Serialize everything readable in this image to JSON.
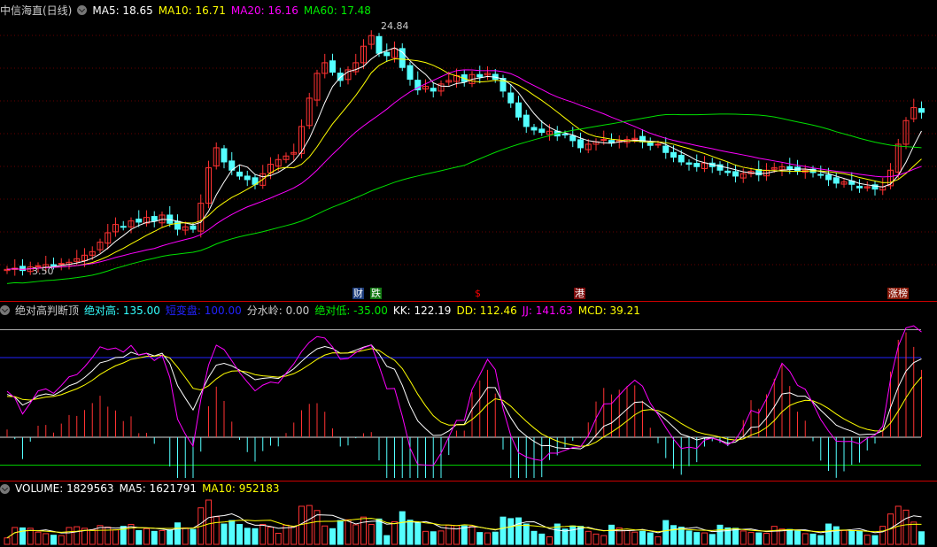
{
  "main": {
    "title": "中信海直(日线)",
    "ma5": "MA5: 18.65",
    "ma10": "MA10: 16.71",
    "ma20": "MA20: 16.16",
    "ma60": "MA60: 17.48",
    "high_label": "24.84",
    "low_label": "3.50",
    "markers": [
      {
        "text": "财",
        "bg": "#1a3a7a",
        "color": "#fff"
      },
      {
        "text": "跌",
        "bg": "#137a13",
        "color": "#fff"
      },
      {
        "text": "$",
        "bg": "transparent",
        "color": "#f00"
      },
      {
        "text": "港",
        "bg": "#7a0a0a",
        "color": "#fff"
      },
      {
        "text": "涨榜",
        "bg": "#8a1a0a",
        "color": "#fff"
      }
    ]
  },
  "indicator": {
    "name": "绝对高判断顶",
    "abs_high": "绝对高: 135.00",
    "short_change": "短变盘: 100.00",
    "watershed": "分水岭: 0.00",
    "abs_low": "绝对低: -35.00",
    "kk": "KK: 122.19",
    "dd": "DD: 112.46",
    "jj": "JJ: 141.63",
    "mcd": "MCD: 39.21"
  },
  "volume": {
    "label": "VOLUME: 1829563",
    "ma5": "MA5: 1621791",
    "ma10": "MA10: 952183"
  },
  "colors": {
    "up": "#ff3232",
    "down": "#54ffff",
    "ma5": "#ffffff",
    "ma10": "#ffff00",
    "ma20": "#ff00ff",
    "ma60": "#00e000"
  },
  "chart_data": {
    "type": "candlestick",
    "ylim": [
      3.1,
      24.84
    ],
    "close": [
      3.9,
      4.0,
      3.8,
      4.1,
      4.2,
      4.3,
      4.2,
      4.4,
      4.5,
      4.8,
      5.1,
      5.4,
      6.2,
      7.0,
      7.7,
      7.5,
      8.0,
      7.9,
      8.3,
      8.0,
      8.5,
      7.8,
      7.3,
      7.5,
      7.3,
      9.5,
      12.5,
      14.2,
      13.0,
      12.3,
      11.8,
      11.5,
      11.1,
      12.0,
      12.8,
      13.2,
      13.5,
      13.8,
      16.0,
      18.4,
      20.5,
      21.4,
      20.6,
      19.9,
      20.8,
      21.4,
      22.8,
      23.7,
      22.2,
      22.0,
      22.6,
      21.0,
      20.0,
      19.1,
      19.4,
      19.0,
      19.6,
      19.9,
      20.3,
      19.8,
      20.4,
      20.2,
      20.5,
      20.0,
      19.0,
      18.0,
      16.8,
      16.0,
      15.7,
      15.5,
      15.6,
      15.2,
      15.3,
      14.8,
      14.2,
      14.5,
      14.7,
      14.9,
      14.6,
      14.8,
      14.9,
      15.0,
      14.7,
      14.4,
      14.5,
      13.8,
      13.4,
      13.0,
      12.8,
      12.6,
      12.9,
      12.6,
      12.3,
      12.1,
      11.8,
      12.0,
      12.2,
      11.9,
      12.3,
      12.5,
      12.6,
      12.4,
      12.2,
      12.3,
      12.1,
      11.9,
      11.5,
      11.2,
      11.3,
      11.1,
      10.8,
      10.9,
      10.7,
      10.9,
      12.3,
      14.5,
      16.5,
      17.6,
      17.2
    ]
  }
}
